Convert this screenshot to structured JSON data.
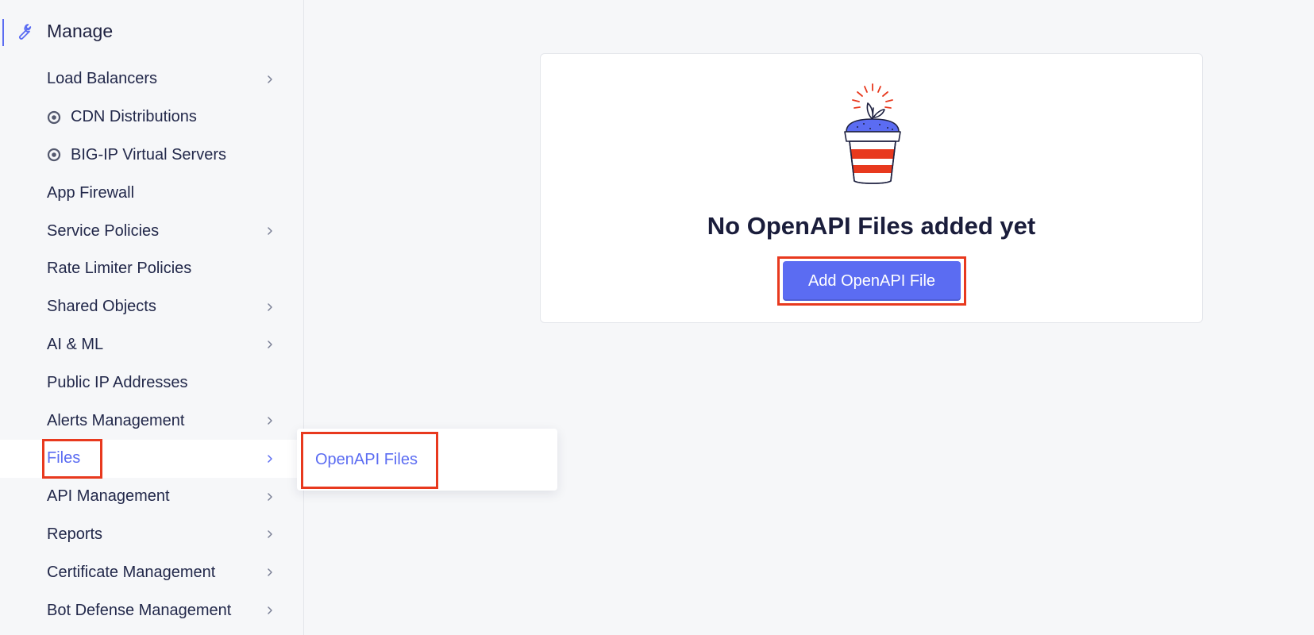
{
  "sidebar": {
    "section_title": "Manage",
    "items": [
      {
        "label": "Load Balancers"
      },
      {
        "label": "CDN Distributions"
      },
      {
        "label": "BIG-IP Virtual Servers"
      },
      {
        "label": "App Firewall"
      },
      {
        "label": "Service Policies"
      },
      {
        "label": "Rate Limiter Policies"
      },
      {
        "label": "Shared Objects"
      },
      {
        "label": "AI & ML"
      },
      {
        "label": "Public IP Addresses"
      },
      {
        "label": "Alerts Management"
      },
      {
        "label": "Files"
      },
      {
        "label": "API Management"
      },
      {
        "label": "Reports"
      },
      {
        "label": "Certificate Management"
      },
      {
        "label": "Bot Defense Management"
      }
    ]
  },
  "flyout": {
    "items": [
      {
        "label": "OpenAPI Files"
      }
    ]
  },
  "main": {
    "empty_title": "No OpenAPI Files added yet",
    "add_button_label": "Add OpenAPI File"
  },
  "colors": {
    "accent": "#5b6cf2",
    "highlight": "#e8391e",
    "text": "#22284a"
  }
}
